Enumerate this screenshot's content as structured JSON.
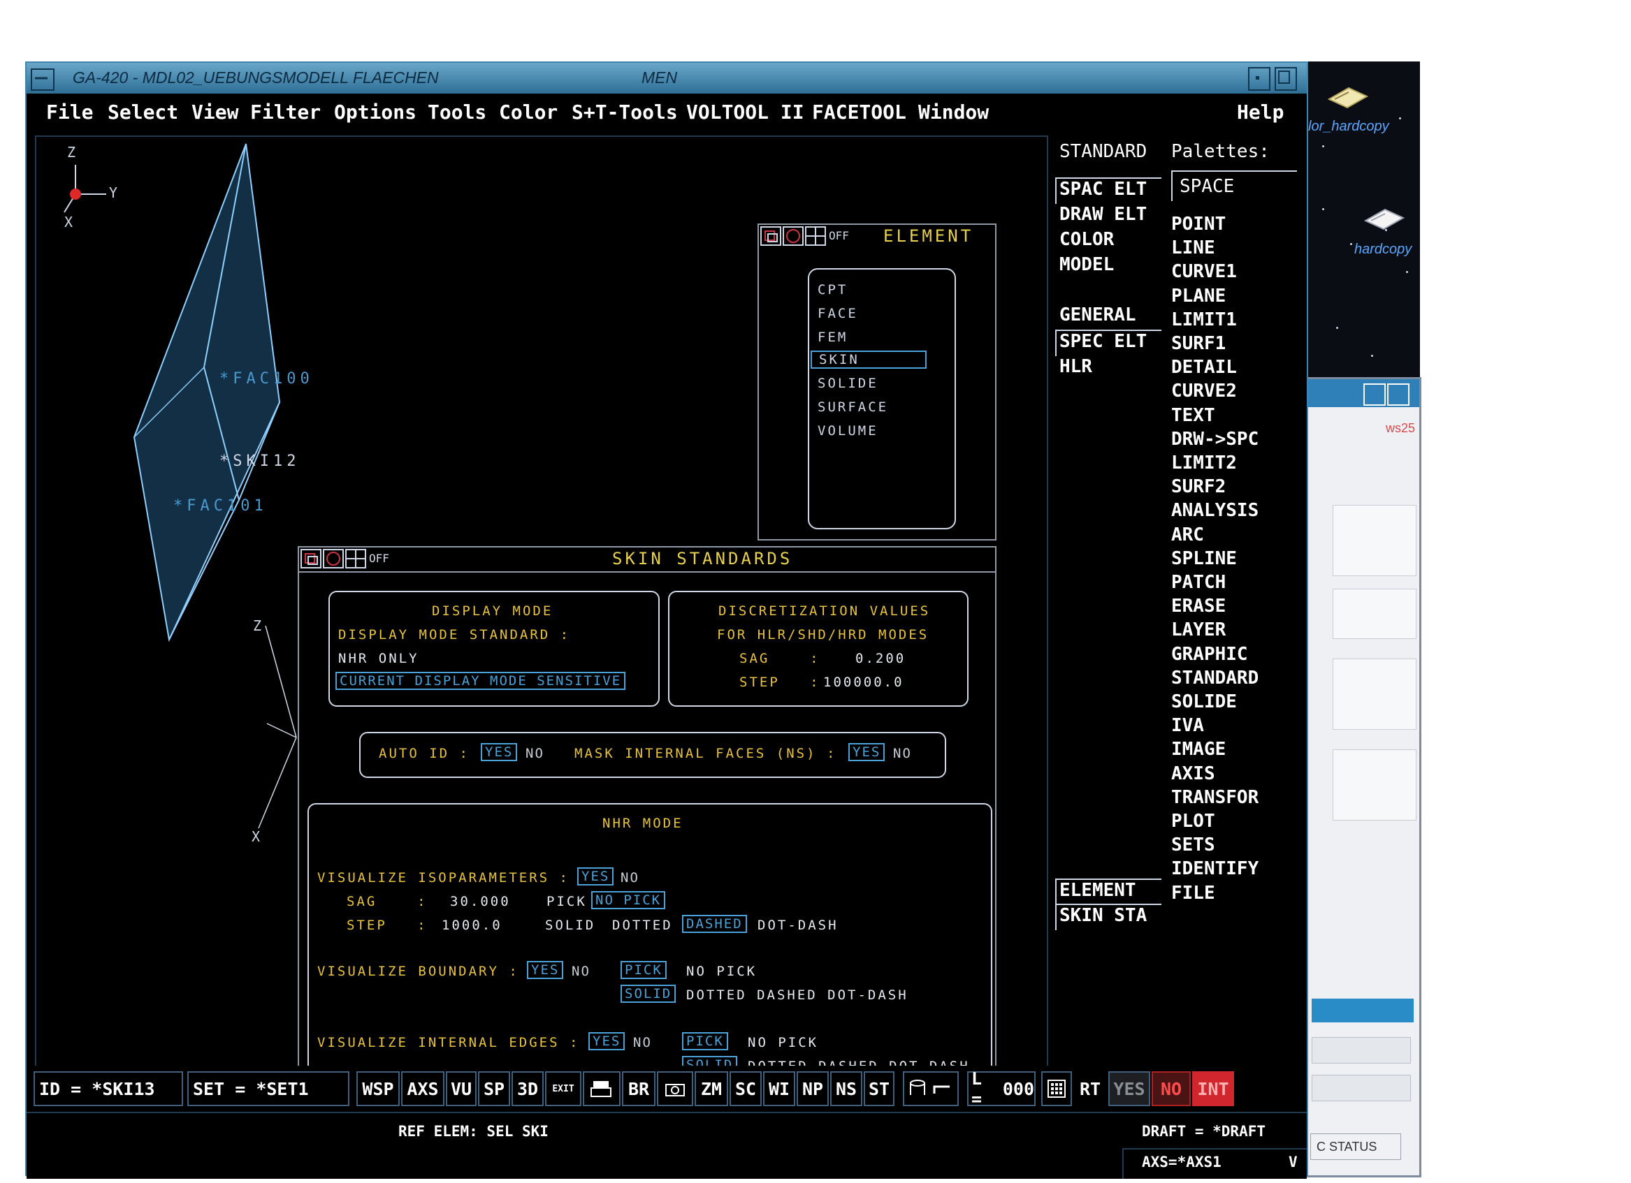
{
  "window": {
    "title": "GA-420 - MDL02_UEBUNGSMODELL FLAECHEN",
    "title_right": "MEN"
  },
  "menubar": {
    "items": [
      "File",
      "Select",
      "View",
      "Filter",
      "Options",
      "Tools",
      "Color",
      "S+T-Tools",
      "VOLTOOL II",
      "FACETOOL",
      "Window"
    ],
    "help": "Help"
  },
  "viewport": {
    "labels": [
      "*FAC100",
      "*SKI12",
      "*FAC101"
    ],
    "triad": {
      "z": "Z",
      "y": "Y",
      "x": "X"
    }
  },
  "element_panel": {
    "title": "ELEMENT",
    "off": "OFF",
    "items": [
      "CPT",
      "FACE",
      "FEM",
      "SKIN",
      "SOLIDE",
      "SURFACE",
      "VOLUME"
    ],
    "selected": "SKIN"
  },
  "skin_panel": {
    "title": "SKIN STANDARDS",
    "off": "OFF",
    "display_mode": {
      "heading": "DISPLAY MODE",
      "standard_label": "DISPLAY MODE STANDARD :",
      "value": "NHR ONLY",
      "sensitive_btn": "CURRENT DISPLAY MODE SENSITIVE"
    },
    "discretization": {
      "heading1": "DISCRETIZATION VALUES",
      "heading2": "FOR HLR/SHD/HRD MODES",
      "sag_label": "SAG    :",
      "sag_value": "0.200",
      "step_label": "STEP   :",
      "step_value": "100000.0"
    },
    "auto_id": {
      "label": "AUTO ID :",
      "yes": "YES",
      "no": "NO",
      "mask_label": "MASK INTERNAL FACES (NS) :",
      "mask_yes": "YES",
      "mask_no": "NO"
    },
    "nhr": {
      "heading": "NHR MODE",
      "iso_label": "VISUALIZE ISOPARAMETERS :",
      "iso_yes": "YES",
      "iso_no": "NO",
      "sag_label": "SAG    :",
      "sag_value": "30.000",
      "pick_label": "PICK",
      "no_pick_btn": "NO PICK",
      "step_label": "STEP   :",
      "step_value": "1000.0",
      "line_solid": "SOLID",
      "line_dotted": "DOTTED",
      "line_dashed": "DASHED",
      "line_dotdash": "DOT-DASH",
      "boundary_label": "VISUALIZE BOUNDARY :",
      "boundary_yes": "YES",
      "boundary_no": "NO",
      "pick_btn": "PICK",
      "no_pick": "NO PICK",
      "solid_btn": "SOLID",
      "rest_styles": "DOTTED DASHED DOT-DASH",
      "internal_label": "VISUALIZE INTERNAL EDGES :",
      "internal_yes": "YES",
      "internal_no": "NO"
    }
  },
  "palette_left": {
    "header": "STANDARD",
    "group1": [
      "SPAC ELT",
      "DRAW ELT",
      "COLOR",
      "MODEL"
    ],
    "group2": [
      "GENERAL",
      "SPEC ELT",
      "HLR"
    ],
    "group3": [
      "ELEMENT",
      "SKIN STA"
    ]
  },
  "palette_right": {
    "header": "Palettes:",
    "current": "SPACE",
    "items": [
      "POINT",
      "LINE",
      "CURVE1",
      "PLANE",
      "LIMIT1",
      "SURF1",
      "DETAIL",
      "CURVE2",
      "TEXT",
      "DRW->SPC",
      "LIMIT2",
      "SURF2",
      "ANALYSIS",
      "ARC",
      "SPLINE",
      "PATCH",
      "ERASE",
      "LAYER",
      "GRAPHIC",
      "STANDARD",
      "SOLIDE",
      "IVA",
      "IMAGE",
      "AXIS",
      "TRANSFOR",
      "PLOT",
      "SETS",
      "IDENTIFY",
      "FILE"
    ]
  },
  "bottombar": {
    "id_label": "ID =",
    "id_value": "*SKI13",
    "set_label": "SET =",
    "set_value": "*SET1",
    "buttons": [
      "WSP",
      "AXS",
      "VU",
      "SP",
      "3D"
    ],
    "exit": "EXIT",
    "buttons2": [
      "BR"
    ],
    "buttons3": [
      "ZM",
      "SC",
      "WI",
      "NP",
      "NS",
      "ST"
    ],
    "l_label": "L =",
    "l_value": "000",
    "rt": "RT",
    "yes": "YES",
    "no": "NO",
    "int": "INT"
  },
  "status": {
    "ref": "REF ELEM: SEL SKI",
    "draft": "DRAFT = *DRAFT",
    "axs": "AXS=*AXS1",
    "v": "V"
  },
  "desktop": {
    "icon1": "lor_hardcopy",
    "icon2": "hardcopy",
    "bg_ws": "ws25",
    "bg_status": "C STATUS"
  },
  "colors": {
    "accent_blue": "#4aa2d8",
    "yellow": "#e8c33b",
    "titlebar": "#2e6f96",
    "no_red": "#d1262e"
  }
}
